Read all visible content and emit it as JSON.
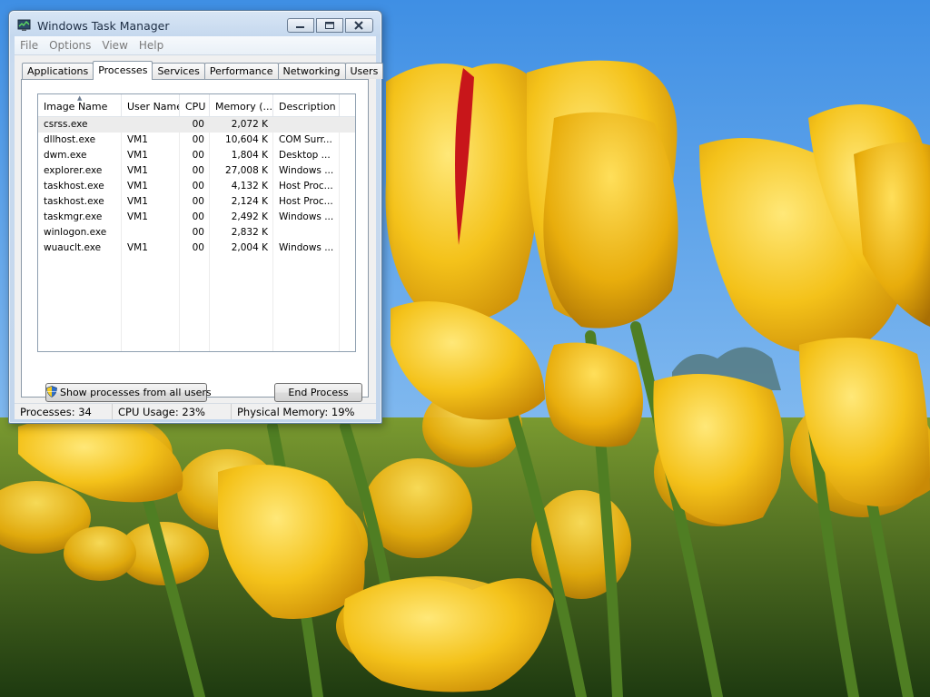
{
  "window": {
    "title": "Windows Task Manager"
  },
  "menu": [
    "File",
    "Options",
    "View",
    "Help"
  ],
  "tabs": [
    {
      "label": "Applications",
      "active": false
    },
    {
      "label": "Processes",
      "active": true
    },
    {
      "label": "Services",
      "active": false
    },
    {
      "label": "Performance",
      "active": false
    },
    {
      "label": "Networking",
      "active": false
    },
    {
      "label": "Users",
      "active": false
    }
  ],
  "process_table": {
    "columns": [
      "Image Name",
      "User Name",
      "CPU",
      "Memory (...",
      "Description"
    ],
    "rows": [
      {
        "image": "csrss.exe",
        "user": "",
        "cpu": "00",
        "memory": "2,072 K",
        "description": "",
        "selected": true
      },
      {
        "image": "dllhost.exe",
        "user": "VM1",
        "cpu": "00",
        "memory": "10,604 K",
        "description": "COM Surr..."
      },
      {
        "image": "dwm.exe",
        "user": "VM1",
        "cpu": "00",
        "memory": "1,804 K",
        "description": "Desktop ..."
      },
      {
        "image": "explorer.exe",
        "user": "VM1",
        "cpu": "00",
        "memory": "27,008 K",
        "description": "Windows ..."
      },
      {
        "image": "taskhost.exe",
        "user": "VM1",
        "cpu": "00",
        "memory": "4,132 K",
        "description": "Host Proc..."
      },
      {
        "image": "taskhost.exe",
        "user": "VM1",
        "cpu": "00",
        "memory": "2,124 K",
        "description": "Host Proc..."
      },
      {
        "image": "taskmgr.exe",
        "user": "VM1",
        "cpu": "00",
        "memory": "2,492 K",
        "description": "Windows ..."
      },
      {
        "image": "winlogon.exe",
        "user": "",
        "cpu": "00",
        "memory": "2,832 K",
        "description": ""
      },
      {
        "image": "wuauclt.exe",
        "user": "VM1",
        "cpu": "00",
        "memory": "2,004 K",
        "description": "Windows ..."
      }
    ]
  },
  "buttons": {
    "show_all": "Show processes from all users",
    "end_process": "End Process"
  },
  "status": {
    "processes": "Processes: 34",
    "cpu": "CPU Usage: 23%",
    "memory": "Physical Memory: 19%"
  },
  "colors": {
    "sky": "#4f9be6",
    "tulip": "#f5c518",
    "stem": "#5c8a2a"
  },
  "icons": [
    "task-manager-icon",
    "minimize-icon",
    "maximize-icon",
    "close-icon",
    "uac-shield-icon",
    "sort-ascending-icon"
  ]
}
